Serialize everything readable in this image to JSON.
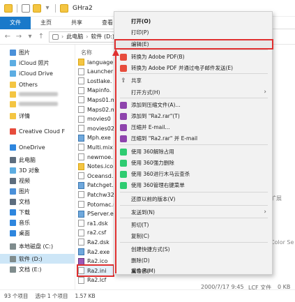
{
  "window": {
    "title": "GHra2"
  },
  "ribbon": {
    "tabs": [
      "文件",
      "主页",
      "共享",
      "查看"
    ]
  },
  "address": {
    "crumbs": [
      "此电脑",
      "软件 (D:)"
    ]
  },
  "navpane": {
    "items": [
      {
        "label": "图片",
        "color": "#4a90d9"
      },
      {
        "label": "iCloud 照片",
        "color": "#5dade2"
      },
      {
        "label": "iCloud Drive",
        "color": "#5dade2"
      },
      {
        "label": "Others",
        "color": "#f4c542"
      },
      {
        "label": "详情",
        "color": "#f4c542"
      },
      {
        "label": "Creative Cloud F",
        "color": "#e74c3c"
      },
      {
        "label": "OneDrive",
        "color": "#2e86de"
      },
      {
        "label": "此电脑",
        "color": "#5d6d7e"
      },
      {
        "label": "3D 对象",
        "color": "#5dade2"
      },
      {
        "label": "视频",
        "color": "#5d6d7e"
      },
      {
        "label": "图片",
        "color": "#4a90d9"
      },
      {
        "label": "文档",
        "color": "#5d6d7e"
      },
      {
        "label": "下载",
        "color": "#2e86de"
      },
      {
        "label": "音乐",
        "color": "#2e86de"
      },
      {
        "label": "桌面",
        "color": "#2e86de"
      },
      {
        "label": "本地磁盘 (C:)",
        "color": "#7f8c8d"
      },
      {
        "label": "软件 (D:)",
        "color": "#7f8c8d"
      },
      {
        "label": "文档 (E:)",
        "color": "#7f8c8d"
      },
      {
        "label": "娱乐 (F:)",
        "color": "#7f8c8d"
      }
    ]
  },
  "filelist": {
    "column_name": "名称",
    "files": [
      {
        "name": "language",
        "type": "folder"
      },
      {
        "name": "Launcher",
        "type": "file"
      },
      {
        "name": "Lostlake.",
        "type": "file"
      },
      {
        "name": "Mapinfo.",
        "type": "file"
      },
      {
        "name": "Maps01.m",
        "type": "file"
      },
      {
        "name": "Maps02.m",
        "type": "file"
      },
      {
        "name": "movies0",
        "type": "file"
      },
      {
        "name": "movies02",
        "type": "file"
      },
      {
        "name": "Mph.exe",
        "type": "app"
      },
      {
        "name": "Multi.mix",
        "type": "file"
      },
      {
        "name": "newmoe.",
        "type": "file"
      },
      {
        "name": "Notes.ico",
        "type": "folder"
      },
      {
        "name": "Oceansd.",
        "type": "file"
      },
      {
        "name": "Patchget.",
        "type": "app"
      },
      {
        "name": "Patchw32.",
        "type": "file"
      },
      {
        "name": "Potomac.n",
        "type": "file"
      },
      {
        "name": "PServer.ex",
        "type": "app"
      },
      {
        "name": "ra1.dsk",
        "type": "file"
      },
      {
        "name": "ra2.csf",
        "type": "file"
      },
      {
        "name": "Ra2.dsk",
        "type": "file"
      },
      {
        "name": "Ra2.exe",
        "type": "app"
      },
      {
        "name": "Ra2.ico",
        "type": "rar"
      },
      {
        "name": "Ra2.ini",
        "type": "file"
      },
      {
        "name": "Ra2.lcf",
        "type": "file"
      }
    ],
    "lcf_date": "2000/7/17 9:45",
    "lcf_type": "LCF 文件",
    "lcf_size": "0 KB",
    "side_text_1": "扩展",
    "side_text_2": "Color Se"
  },
  "statusbar": {
    "count": "93 个项目",
    "selected": "选中 1 个项目",
    "size": "1.57 KB"
  },
  "context_menu": {
    "items": [
      {
        "label": "打开(O)",
        "icon": "none",
        "bold": true
      },
      {
        "label": "打印(P)",
        "icon": "none"
      },
      {
        "label": "编辑(E)",
        "icon": "none",
        "boxed": true
      },
      {
        "label": "转换为 Adobe PDF(B)",
        "icon": "pdf"
      },
      {
        "label": "转换为 Adobe PDF 并通过电子邮件发送(E)",
        "icon": "pdf"
      },
      {
        "label": "共享",
        "icon": "share"
      },
      {
        "label": "打开方式(H)",
        "icon": "none",
        "submenu": true
      },
      {
        "label": "添加到压缩文件(A)...",
        "icon": "rar"
      },
      {
        "label": "添加到 \"Ra2.rar\"(T)",
        "icon": "rar"
      },
      {
        "label": "压缩并 E-mail...",
        "icon": "rar"
      },
      {
        "label": "压缩到 \"Ra2.rar\" 并 E-mail",
        "icon": "rar"
      },
      {
        "label": "使用 360解除占用",
        "icon": "360"
      },
      {
        "label": "使用 360强力删除",
        "icon": "360"
      },
      {
        "label": "使用 360进行木马云查杀",
        "icon": "360"
      },
      {
        "label": "使用 360管理右键菜单",
        "icon": "360"
      },
      {
        "label": "还原以前的版本(V)",
        "icon": "none"
      },
      {
        "label": "发送到(N)",
        "icon": "none",
        "submenu": true
      },
      {
        "label": "剪切(T)",
        "icon": "none"
      },
      {
        "label": "复制(C)",
        "icon": "none"
      },
      {
        "label": "创建快捷方式(S)",
        "icon": "none"
      },
      {
        "label": "删除(D)",
        "icon": "none"
      },
      {
        "label": "重命名(M)",
        "icon": "none"
      },
      {
        "label": "属性(R)",
        "icon": "none"
      }
    ],
    "share_glyph": "⇪",
    "submenu_glyph": "›"
  },
  "colors": {
    "accent": "#1979ca",
    "highlight": "#e03030"
  }
}
